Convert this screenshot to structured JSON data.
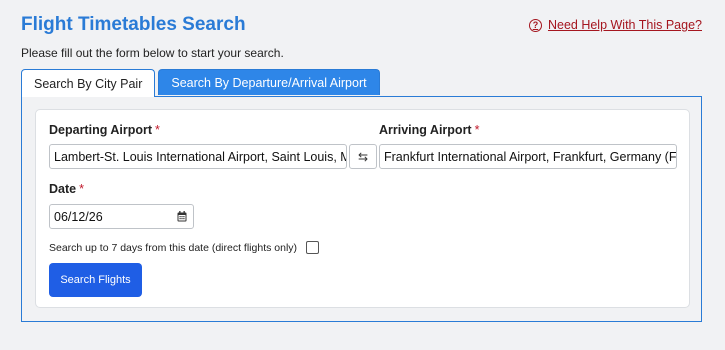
{
  "header": {
    "title": "Flight Timetables Search",
    "help_icon": "question-circle-icon",
    "help_link": "Need Help With This Page?",
    "instructions": "Please fill out the form below to start your search."
  },
  "tabs": [
    {
      "label": "Search By City Pair",
      "active": true
    },
    {
      "label": "Search By Departure/Arrival Airport",
      "active": false
    }
  ],
  "form": {
    "departing": {
      "label": "Departing Airport",
      "required": "*",
      "value": "Lambert-St. Louis International Airport, Saint Louis, M"
    },
    "swap_icon": "swap-arrows-icon",
    "arriving": {
      "label": "Arriving Airport",
      "required": "*",
      "value": "Frankfurt International Airport, Frankfurt, Germany (FF"
    },
    "date": {
      "label": "Date",
      "required": "*",
      "value": "06/12/26",
      "icon": "calendar-icon"
    },
    "flex_search": {
      "label": "Search up to 7 days from this date (direct flights only)",
      "checked": false
    },
    "submit_label": "Search Flights"
  },
  "colors": {
    "title": "#2a7bd6",
    "help_link": "#a5161f",
    "required_marker": "#c0182a",
    "tab_inactive": "#2e86e8",
    "primary_button": "#1f5ee5",
    "background": "#f1f2f4"
  }
}
